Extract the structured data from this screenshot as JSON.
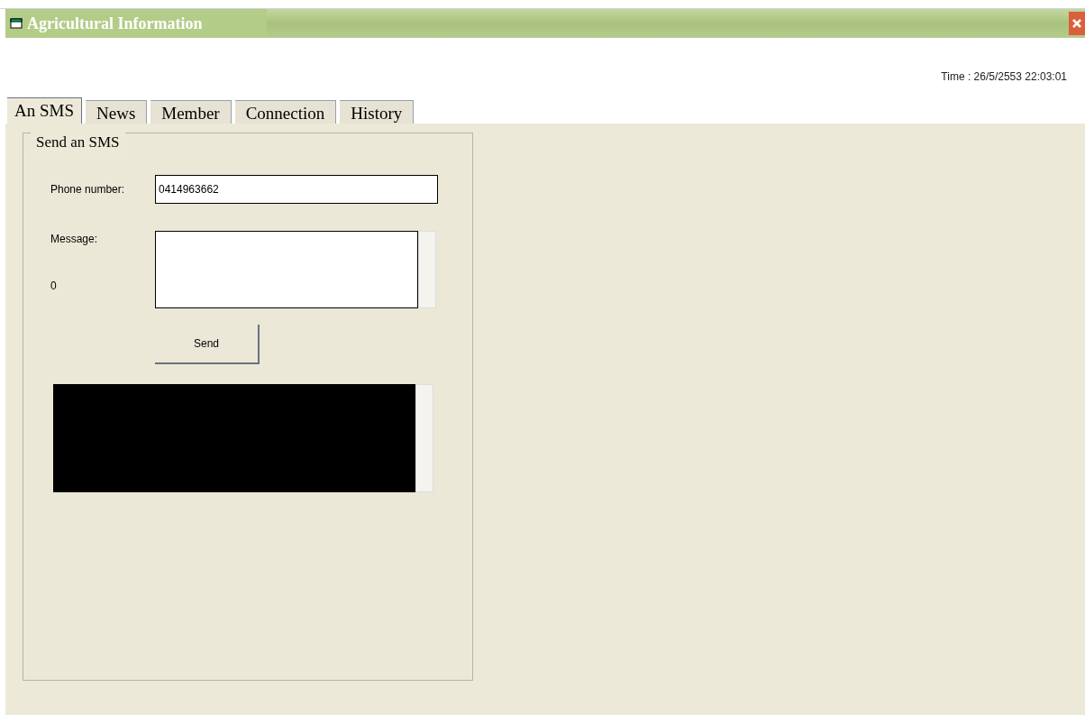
{
  "window": {
    "title": "Agricultural Information"
  },
  "time": "Time : 26/5/2553 22:03:01",
  "tabs": [
    {
      "label": "An SMS",
      "selected": true
    },
    {
      "label": "News",
      "selected": false
    },
    {
      "label": "Member",
      "selected": false
    },
    {
      "label": "Connection",
      "selected": false
    },
    {
      "label": "History",
      "selected": false
    }
  ],
  "group": {
    "title": "Send an SMS",
    "phone_label": "Phone number:",
    "phone_value": "0414963662",
    "message_label": "Message:",
    "char_count": "0",
    "send_button": "Send"
  }
}
